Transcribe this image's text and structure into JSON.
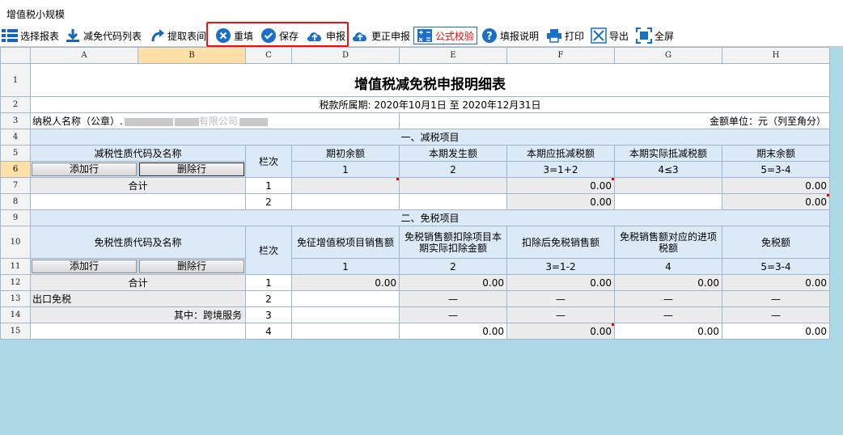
{
  "window": {
    "title": "增值税小规模"
  },
  "toolbar": {
    "select_report": "选择报表",
    "exemption_codes": "减免代码列表",
    "fetch_table": "提取表间",
    "refill": "重填",
    "save": "保存",
    "declare": "申报",
    "correct_declare": "更正申报",
    "formula_check": "公式校验",
    "fill_guide": "填报说明",
    "print": "打印",
    "export": "导出",
    "fullscreen": "全屏"
  },
  "columns": [
    "A",
    "B",
    "C",
    "D",
    "E",
    "F",
    "G",
    "H"
  ],
  "rows": [
    "1",
    "2",
    "3",
    "4",
    "5",
    "6",
    "7",
    "8",
    "9",
    "10",
    "11",
    "12",
    "13",
    "14",
    "15"
  ],
  "sheet": {
    "title": "增值税减免税申报明细表",
    "period": "税款所属期:  2020年10月1日 至 2020年12月31日",
    "taxpayer_label": "纳税人名称（公章）.",
    "taxpayer_tail": "有限公司",
    "unit": "金额单位：元（列至角分）",
    "section1": "一、减税项目",
    "section2": "二、免税项目",
    "reduce_code_header": "减税性质代码及名称",
    "line_header": "栏次",
    "h_opening": "期初余额",
    "h_current": "本期发生额",
    "h_should_deduct": "本期应抵减税额",
    "h_actual_deduct": "本期实际抵减税额",
    "h_closing": "期末余额",
    "c1": "1",
    "c2": "2",
    "c3": "3=1+2",
    "c4": "4≤3",
    "c5": "5=3-4",
    "add_row": "添加行",
    "del_row": "删除行",
    "total": "合计",
    "l1": "1",
    "l2": "2",
    "l3": "3",
    "l4": "4",
    "zero": "0.00",
    "exempt_code_header": "免税性质代码及名称",
    "h_exempt_sales": "免征增值税项目销售额",
    "h_exempt_deduct": "免税销售额扣除项目本期实际扣除金额",
    "h_after_deduct": "扣除后免税销售额",
    "h_input_tax": "免税销售额对应的进项税额",
    "h_exempt_tax": "免税额",
    "e3": "3=1-2",
    "export_exempt": "出口免税",
    "cross_border": "其中：跨境服务",
    "dash": "—"
  }
}
